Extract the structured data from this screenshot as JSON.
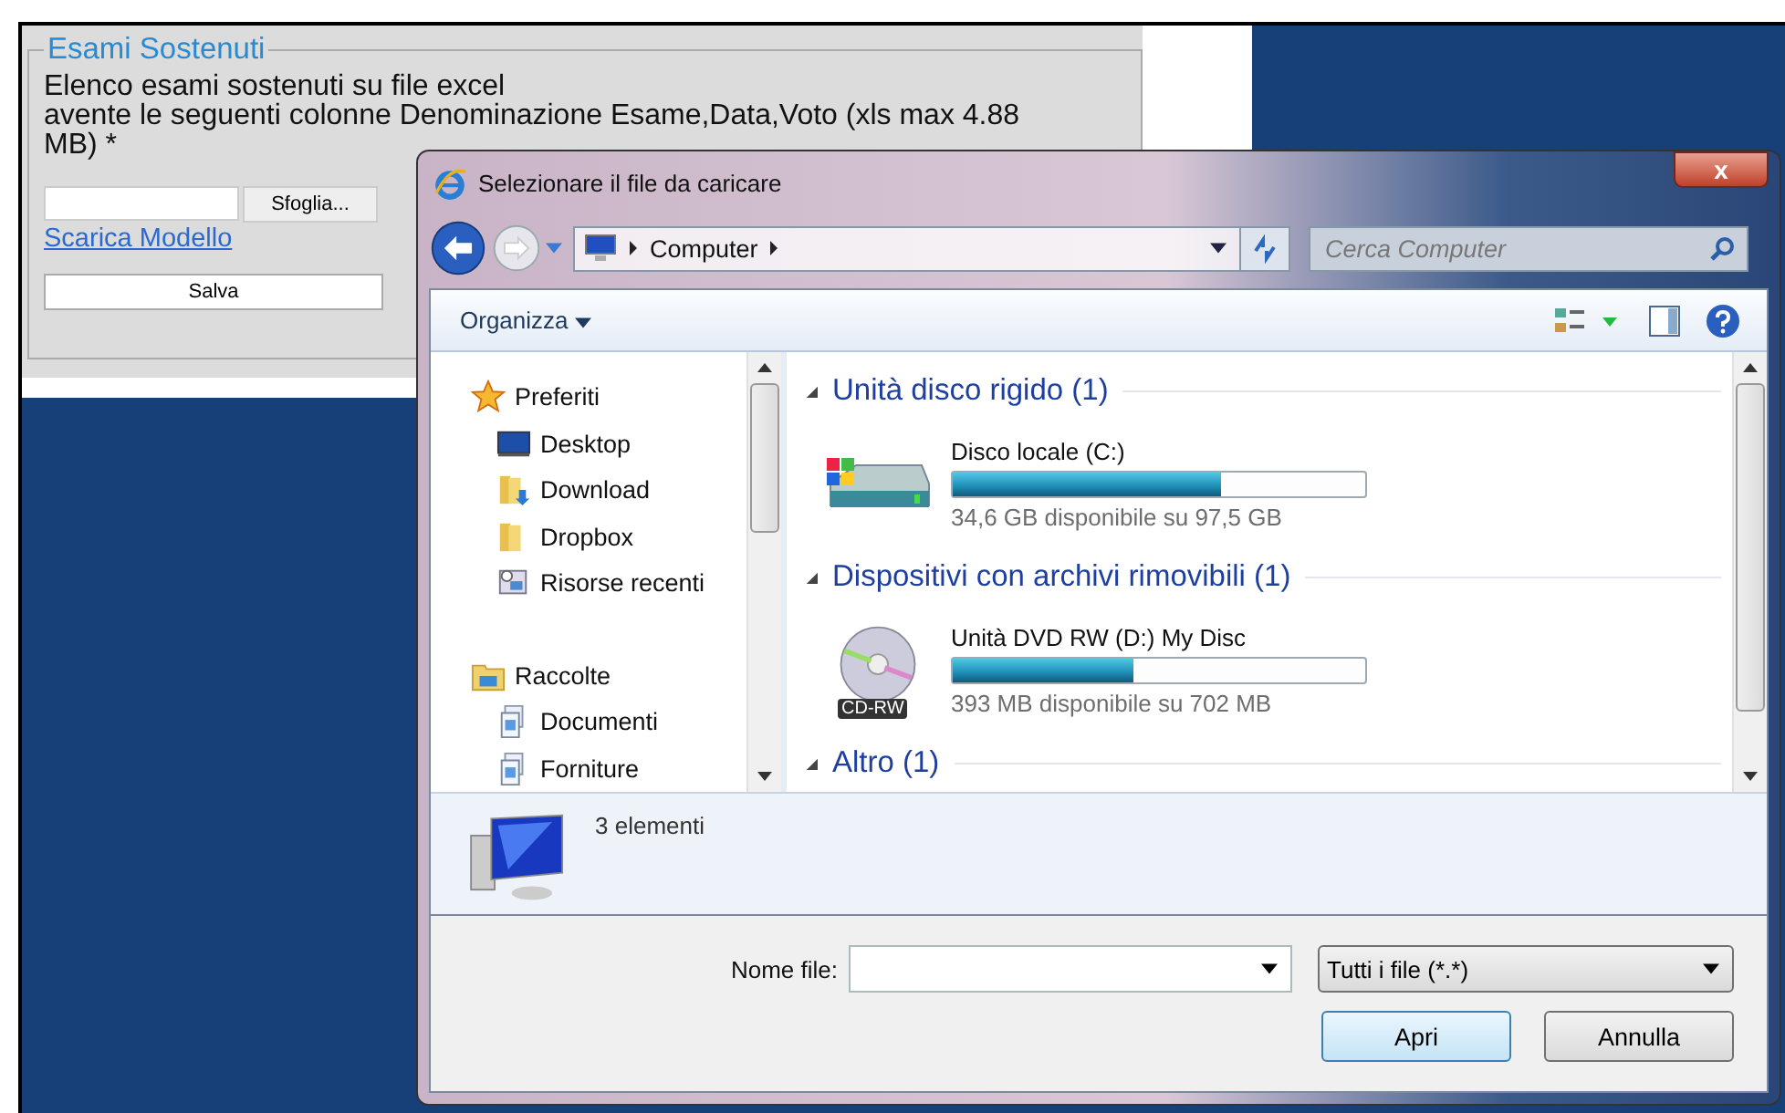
{
  "form": {
    "legend": "Esami Sostenuti",
    "lines": [
      "Elenco esami sostenuti su file excel",
      "avente le seguenti colonne Denominazione Esame,Data,Voto (xls max 4.88 MB) *"
    ],
    "browse_button": "Sfoglia...",
    "template_link": "Scarica Modello",
    "save_button": "Salva"
  },
  "dialog": {
    "title": "Selezionare il file da caricare",
    "close": "x",
    "address": [
      "Computer"
    ],
    "search": {
      "placeholder": "Cerca Computer"
    },
    "organize": "Organizza",
    "nav": [
      {
        "label": "Preferiti",
        "kind": "star",
        "children": [
          {
            "label": "Desktop",
            "kind": "desktop"
          },
          {
            "label": "Download",
            "kind": "download"
          },
          {
            "label": "Dropbox",
            "kind": "folder"
          },
          {
            "label": "Risorse recenti",
            "kind": "recent"
          }
        ]
      },
      {
        "label": "Raccolte",
        "kind": "library",
        "children": [
          {
            "label": "Documenti",
            "kind": "doc"
          },
          {
            "label": "Forniture",
            "kind": "doc"
          }
        ]
      }
    ],
    "groups": [
      {
        "title": "Unità disco rigido (1)",
        "expanded": true,
        "drives": [
          {
            "name": "Disco locale (C:)",
            "kind": "hdd",
            "level": 0.65,
            "free": "34,6 GB disponibile su 97,5 GB"
          }
        ]
      },
      {
        "title": "Dispositivi con archivi rimovibili (1)",
        "expanded": true,
        "drives": [
          {
            "name": "Unità DVD RW (D:) My Disc",
            "kind": "dvd",
            "level": 0.44,
            "free": "393 MB disponibile su 702 MB",
            "badge": "CD-RW"
          }
        ]
      },
      {
        "title": "Altro (1)",
        "expanded": true
      }
    ],
    "details": "3 elementi",
    "filename_label": "Nome file:",
    "filetype": "Tutti i file (*.*)",
    "open_button": "Apri",
    "cancel_button": "Annulla"
  }
}
